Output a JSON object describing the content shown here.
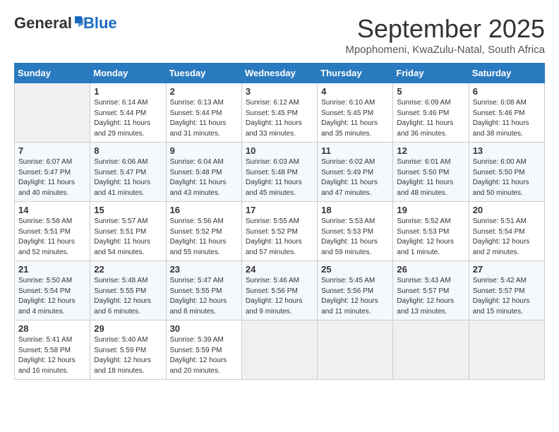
{
  "header": {
    "logo_general": "General",
    "logo_blue": "Blue",
    "title": "September 2025",
    "subtitle": "Mpophomeni, KwaZulu-Natal, South Africa"
  },
  "weekdays": [
    "Sunday",
    "Monday",
    "Tuesday",
    "Wednesday",
    "Thursday",
    "Friday",
    "Saturday"
  ],
  "weeks": [
    [
      {
        "day": "",
        "empty": true
      },
      {
        "day": "1",
        "sunrise": "6:14 AM",
        "sunset": "5:44 PM",
        "daylight": "11 hours and 29 minutes."
      },
      {
        "day": "2",
        "sunrise": "6:13 AM",
        "sunset": "5:44 PM",
        "daylight": "11 hours and 31 minutes."
      },
      {
        "day": "3",
        "sunrise": "6:12 AM",
        "sunset": "5:45 PM",
        "daylight": "11 hours and 33 minutes."
      },
      {
        "day": "4",
        "sunrise": "6:10 AM",
        "sunset": "5:45 PM",
        "daylight": "11 hours and 35 minutes."
      },
      {
        "day": "5",
        "sunrise": "6:09 AM",
        "sunset": "5:46 PM",
        "daylight": "11 hours and 36 minutes."
      },
      {
        "day": "6",
        "sunrise": "6:08 AM",
        "sunset": "5:46 PM",
        "daylight": "11 hours and 38 minutes."
      }
    ],
    [
      {
        "day": "7",
        "sunrise": "6:07 AM",
        "sunset": "5:47 PM",
        "daylight": "11 hours and 40 minutes."
      },
      {
        "day": "8",
        "sunrise": "6:06 AM",
        "sunset": "5:47 PM",
        "daylight": "11 hours and 41 minutes."
      },
      {
        "day": "9",
        "sunrise": "6:04 AM",
        "sunset": "5:48 PM",
        "daylight": "11 hours and 43 minutes."
      },
      {
        "day": "10",
        "sunrise": "6:03 AM",
        "sunset": "5:48 PM",
        "daylight": "11 hours and 45 minutes."
      },
      {
        "day": "11",
        "sunrise": "6:02 AM",
        "sunset": "5:49 PM",
        "daylight": "11 hours and 47 minutes."
      },
      {
        "day": "12",
        "sunrise": "6:01 AM",
        "sunset": "5:50 PM",
        "daylight": "11 hours and 48 minutes."
      },
      {
        "day": "13",
        "sunrise": "6:00 AM",
        "sunset": "5:50 PM",
        "daylight": "11 hours and 50 minutes."
      }
    ],
    [
      {
        "day": "14",
        "sunrise": "5:58 AM",
        "sunset": "5:51 PM",
        "daylight": "11 hours and 52 minutes."
      },
      {
        "day": "15",
        "sunrise": "5:57 AM",
        "sunset": "5:51 PM",
        "daylight": "11 hours and 54 minutes."
      },
      {
        "day": "16",
        "sunrise": "5:56 AM",
        "sunset": "5:52 PM",
        "daylight": "11 hours and 55 minutes."
      },
      {
        "day": "17",
        "sunrise": "5:55 AM",
        "sunset": "5:52 PM",
        "daylight": "11 hours and 57 minutes."
      },
      {
        "day": "18",
        "sunrise": "5:53 AM",
        "sunset": "5:53 PM",
        "daylight": "11 hours and 59 minutes."
      },
      {
        "day": "19",
        "sunrise": "5:52 AM",
        "sunset": "5:53 PM",
        "daylight": "12 hours and 1 minute."
      },
      {
        "day": "20",
        "sunrise": "5:51 AM",
        "sunset": "5:54 PM",
        "daylight": "12 hours and 2 minutes."
      }
    ],
    [
      {
        "day": "21",
        "sunrise": "5:50 AM",
        "sunset": "5:54 PM",
        "daylight": "12 hours and 4 minutes."
      },
      {
        "day": "22",
        "sunrise": "5:48 AM",
        "sunset": "5:55 PM",
        "daylight": "12 hours and 6 minutes."
      },
      {
        "day": "23",
        "sunrise": "5:47 AM",
        "sunset": "5:55 PM",
        "daylight": "12 hours and 8 minutes."
      },
      {
        "day": "24",
        "sunrise": "5:46 AM",
        "sunset": "5:56 PM",
        "daylight": "12 hours and 9 minutes."
      },
      {
        "day": "25",
        "sunrise": "5:45 AM",
        "sunset": "5:56 PM",
        "daylight": "12 hours and 11 minutes."
      },
      {
        "day": "26",
        "sunrise": "5:43 AM",
        "sunset": "5:57 PM",
        "daylight": "12 hours and 13 minutes."
      },
      {
        "day": "27",
        "sunrise": "5:42 AM",
        "sunset": "5:57 PM",
        "daylight": "12 hours and 15 minutes."
      }
    ],
    [
      {
        "day": "28",
        "sunrise": "5:41 AM",
        "sunset": "5:58 PM",
        "daylight": "12 hours and 16 minutes."
      },
      {
        "day": "29",
        "sunrise": "5:40 AM",
        "sunset": "5:59 PM",
        "daylight": "12 hours and 18 minutes."
      },
      {
        "day": "30",
        "sunrise": "5:39 AM",
        "sunset": "5:59 PM",
        "daylight": "12 hours and 20 minutes."
      },
      {
        "day": "",
        "empty": true
      },
      {
        "day": "",
        "empty": true
      },
      {
        "day": "",
        "empty": true
      },
      {
        "day": "",
        "empty": true
      }
    ]
  ]
}
